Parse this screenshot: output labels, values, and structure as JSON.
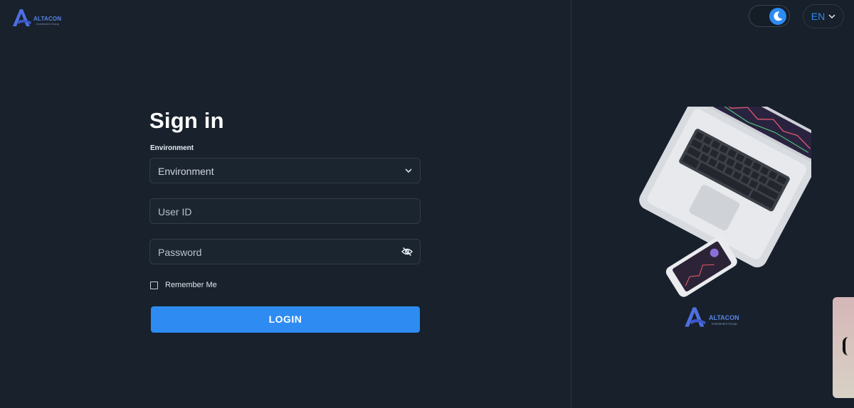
{
  "brand": {
    "name": "ALTACON",
    "tagline": "Investment Group",
    "color": "#5b84e8"
  },
  "header": {
    "theme_toggle_icon": "moon-icon",
    "language": "EN"
  },
  "form": {
    "title": "Sign in",
    "environment_label": "Environment",
    "environment_value": "Environment",
    "user_id_placeholder": "User ID",
    "password_placeholder": "Password",
    "remember_label": "Remember Me",
    "login_label": "LOGIN"
  },
  "colors": {
    "background": "#18212c",
    "accent": "#2d8bf2"
  }
}
